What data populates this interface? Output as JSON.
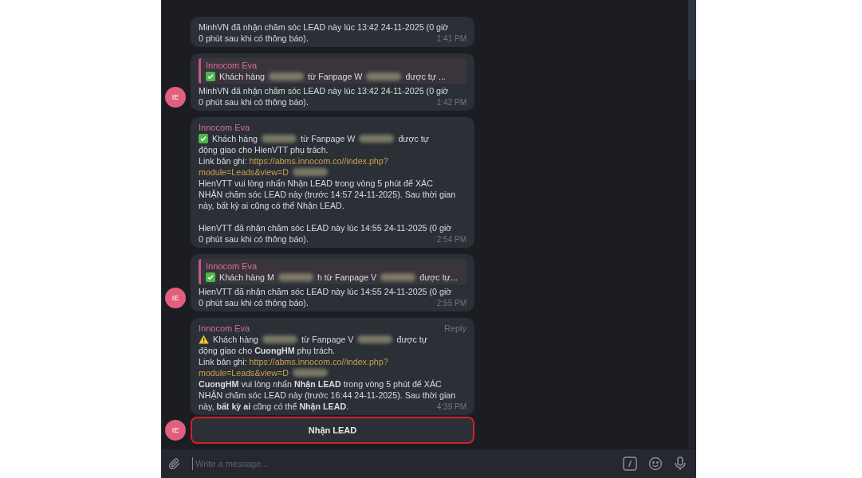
{
  "messages": [
    {
      "kind": "plain",
      "lines": [
        [
          {
            "kind": "text",
            "text": "MinhVN đã nhận chăm sóc LEAD này lúc 13:42 24-11-2025 (0 giờ"
          }
        ],
        [
          {
            "kind": "text",
            "text": "0 phút sau khi có thông báo)."
          }
        ]
      ],
      "time": "1:41 PM"
    },
    {
      "kind": "quoted",
      "avatar": "IE",
      "quote": {
        "sender": "Innocom Eva",
        "segments": [
          {
            "kind": "check"
          },
          {
            "kind": "text",
            "text": "Khách hàng"
          },
          {
            "kind": "redacted"
          },
          {
            "kind": "text",
            "text": "từ Fanpage W"
          },
          {
            "kind": "redacted"
          },
          {
            "kind": "text",
            "text": "được tự ..."
          }
        ]
      },
      "lines": [
        [
          {
            "kind": "text",
            "text": "MinhVN đã nhận chăm sóc LEAD này lúc 13:42 24-11-2025 (0 giờ"
          }
        ],
        [
          {
            "kind": "text",
            "text": "0 phút sau khi có thông báo)."
          }
        ]
      ],
      "time": "1:42 PM"
    },
    {
      "kind": "plain",
      "sender": "Innocom Eva",
      "lines": [
        [
          {
            "kind": "check"
          },
          {
            "kind": "text",
            "text": "Khách hàng"
          },
          {
            "kind": "redacted"
          },
          {
            "kind": "text",
            "text": "từ Fanpage W"
          },
          {
            "kind": "redacted"
          },
          {
            "kind": "text",
            "text": "được tự"
          }
        ],
        [
          {
            "kind": "text",
            "text": "động giao cho HienVTT phụ trách."
          }
        ],
        [
          {
            "kind": "text",
            "text": "Link bản ghi:"
          },
          {
            "kind": "link",
            "text": "https://abms.innocom.co//index.php?"
          }
        ],
        [
          {
            "kind": "link",
            "text": "module=Leads&view=D"
          },
          {
            "kind": "redacted"
          }
        ],
        [
          {
            "kind": "text",
            "text": "HienVTT vui lòng nhấn Nhận LEAD trong vòng 5 phút để XÁC"
          }
        ],
        [
          {
            "kind": "text",
            "text": "NHẬN chăm sóc LEAD này (trước 14:57 24-11-2025). Sau thời gian"
          }
        ],
        [
          {
            "kind": "text",
            "text": "này, bất kỳ ai cũng có thể Nhận LEAD."
          }
        ],
        [
          {
            "kind": "gap"
          }
        ],
        [
          {
            "kind": "text",
            "text": "HienVTT đã nhận chăm sóc LEAD này lúc 14:55 24-11-2025 (0 giờ"
          }
        ],
        [
          {
            "kind": "text",
            "text": "0 phút sau khi có thông báo)."
          }
        ]
      ],
      "time": "2:54 PM"
    },
    {
      "kind": "quoted",
      "avatar": "IE",
      "quote": {
        "sender": "Innocom Eva",
        "segments": [
          {
            "kind": "check"
          },
          {
            "kind": "text",
            "text": "Khách hàng M"
          },
          {
            "kind": "redacted"
          },
          {
            "kind": "text",
            "text": "h từ Fanpage V"
          },
          {
            "kind": "redacted"
          },
          {
            "kind": "text",
            "text": "được tự..."
          }
        ]
      },
      "lines": [
        [
          {
            "kind": "text",
            "text": "HienVTT đã nhận chăm sóc LEAD này lúc 14:55 24-11-2025 (0 giờ"
          }
        ],
        [
          {
            "kind": "text",
            "text": "0 phút sau khi có thông báo)."
          }
        ]
      ],
      "time": "2:55 PM"
    },
    {
      "kind": "plain",
      "sender": "Innocom Eva",
      "avatar": "IE",
      "reply_label": "Reply",
      "lines": [
        [
          {
            "kind": "warning"
          },
          {
            "kind": "text",
            "text": "Khách hàng"
          },
          {
            "kind": "redacted"
          },
          {
            "kind": "text",
            "text": "từ Fanpage V"
          },
          {
            "kind": "redacted"
          },
          {
            "kind": "text",
            "text": "được tự"
          }
        ],
        [
          {
            "kind": "text",
            "text": "động giao cho **CuongHM** phụ trách."
          }
        ],
        [
          {
            "kind": "text",
            "text": "Link bản ghi:"
          },
          {
            "kind": "link",
            "text": "https://abms.innocom.co//index.php?"
          }
        ],
        [
          {
            "kind": "link",
            "text": "module=Leads&view=D"
          },
          {
            "kind": "redacted"
          }
        ],
        [
          {
            "kind": "text",
            "text": "**CuongHM** vui lòng nhấn **Nhận LEAD** trong vòng 5 phút để XÁC"
          }
        ],
        [
          {
            "kind": "text",
            "text": "NHẬN chăm sóc LEAD này (trước 16:44 24-11-2025). Sau thời gian"
          }
        ],
        [
          {
            "kind": "text",
            "text": "này, **bất kỳ ai** cũng có thể **Nhận LEAD**."
          }
        ]
      ],
      "time": "4:39 PM",
      "button": {
        "label": "Nhận LEAD",
        "highlighted": true
      }
    }
  ],
  "composer": {
    "placeholder": "Write a message..."
  }
}
